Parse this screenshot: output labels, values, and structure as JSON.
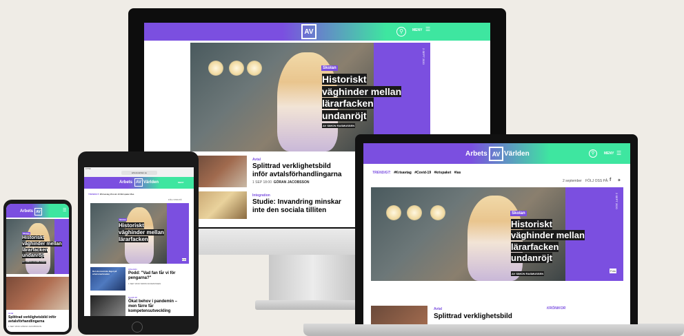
{
  "brand": {
    "word1": "Arbets",
    "word2": "Världen",
    "logo": "AV",
    "accent": "#7b4fe0",
    "accent2": "#3ee6a0"
  },
  "menu_label": "MENY",
  "hero": {
    "category": "Skolan",
    "title_l1": "Historiskt",
    "title_l2": "väghinder mellan",
    "title_l3": "lärarfacken",
    "title_l4": "undanröjt",
    "title_full": "Historiskt väghinder mellan lärarfacken undanröjt",
    "byline": "AV SIMON RASMUSSEN",
    "side_date": "2 SEPT 2020",
    "photo_badge": "Foto"
  },
  "articles": [
    {
      "category": "Avtal",
      "title_l1": "Splittrad verklighetsbild",
      "title_l2": "inför avtalsförhandlingarna",
      "meta": "1 SEP 18:00",
      "author": "GÖRAN JACOBSSON"
    },
    {
      "category": "Integration",
      "title_l1": "Studie: Invandring minskar",
      "title_l2": "inte den sociala tilliten"
    }
  ],
  "trending": {
    "label": "TRENDIGT:",
    "items": [
      "#Krisavtag",
      "#Covid-19",
      "#krispaket",
      "#las"
    ]
  },
  "laptop_meta": {
    "date": "2 september",
    "follow": "FÖLJ OSS PÅ:"
  },
  "laptop_bottom": {
    "category": "Avtal",
    "title": "Splittrad verklighetsbild",
    "kronikor": "KRÖNIKOR"
  },
  "tablet": {
    "url": "arbetsvarlden.se",
    "status": "17:54",
    "trending_items": "#Krisavtag  #Covid-19  #krispaket  #las",
    "follow": "FÖLJ OSS PÅ:",
    "card1": {
      "category": "Arbetsliv",
      "title_l1": "Podd: \"Vad fan får vi för",
      "title_l2": "pengarna?\"",
      "meta": "1 SEP 18:00",
      "author": "SIMON RASMUSSEN",
      "thumb_text": "Det ekonomiska läget på arbetsmarknaden"
    },
    "card2": {
      "category": "Covid-19",
      "title_l1": "Ökat behov i pandemin –",
      "title_l2": "men färre får",
      "title_l3": "kompetensutveckling"
    }
  },
  "phone": {
    "category": "Avtal",
    "title_l1": "Splittrad verklighetsbild inför",
    "title_l2": "avtalsförhandlingarna",
    "meta": "1 SEP 18:00",
    "author": "GÖRAN JACOBSSON",
    "byline": "AV SIMON RASMUSSEN"
  }
}
